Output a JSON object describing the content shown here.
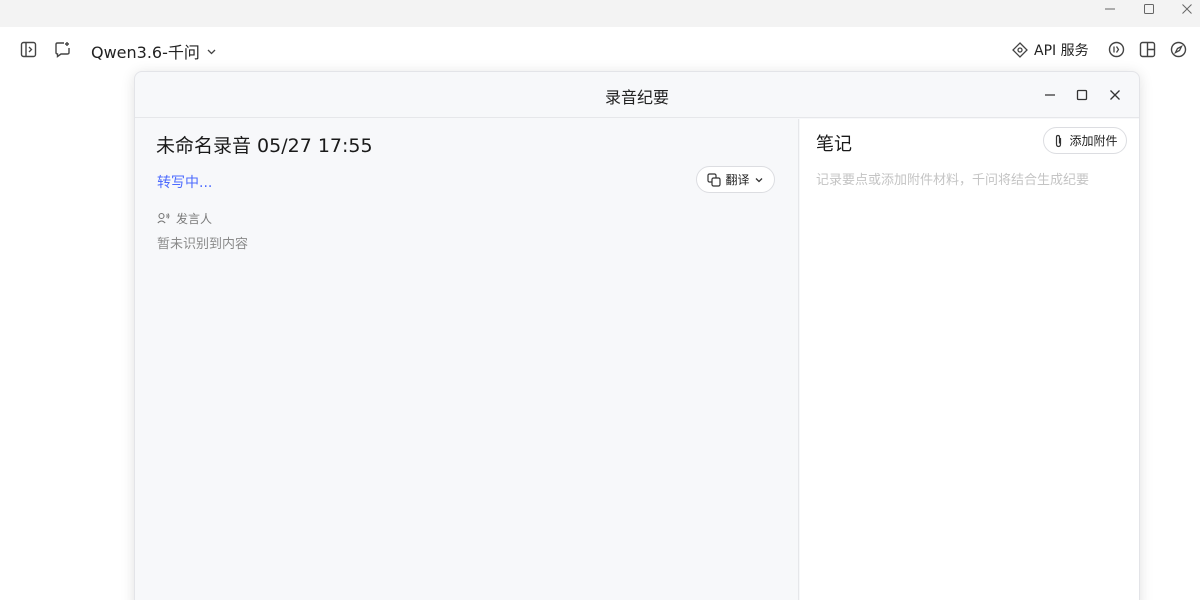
{
  "header": {
    "model_name": "Qwen3.6-千问",
    "api_label": "API 服务"
  },
  "modal": {
    "title": "录音纪要",
    "recording_title": "未命名录音 05/27 17:55",
    "status": "转写中...",
    "translate_label": "翻译",
    "speaker_label": "发言人",
    "empty_text": "暂未识别到内容",
    "notes_title": "笔记",
    "attach_label": "添加附件",
    "notes_placeholder": "记录要点或添加附件材料，千问将结合生成纪要"
  },
  "colors": {
    "accent": "#4d6bfe",
    "modal_bg": "#f7f8fa"
  }
}
